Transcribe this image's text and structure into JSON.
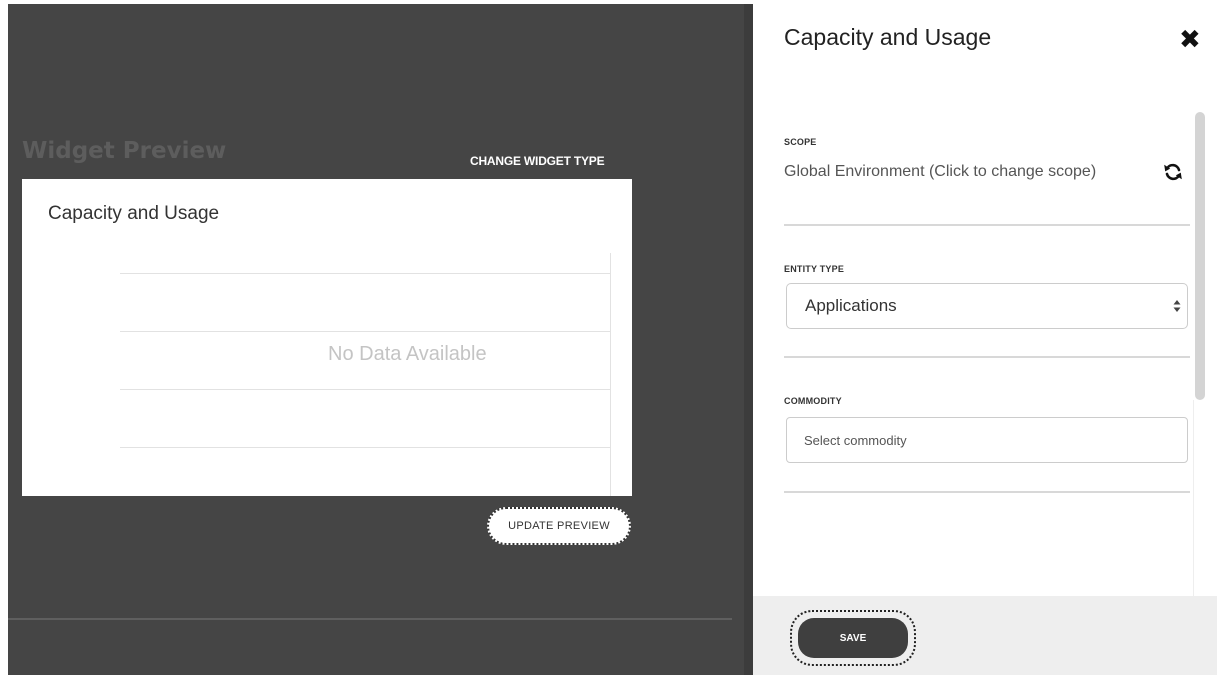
{
  "preview": {
    "title": "Widget Preview",
    "change_type_label": "CHANGE WIDGET TYPE",
    "card_title": "Capacity and Usage",
    "empty_message": "No Data Available",
    "update_label": "UPDATE PREVIEW"
  },
  "panel": {
    "title": "Capacity and Usage",
    "close_icon": "close-icon",
    "scope": {
      "label": "SCOPE",
      "value": "Global Environment (Click to change scope)",
      "icon": "refresh-icon"
    },
    "entity_type": {
      "label": "ENTITY TYPE",
      "selected": "Applications"
    },
    "commodity": {
      "label": "COMMODITY",
      "placeholder": "Select commodity"
    },
    "save_label": "SAVE"
  }
}
